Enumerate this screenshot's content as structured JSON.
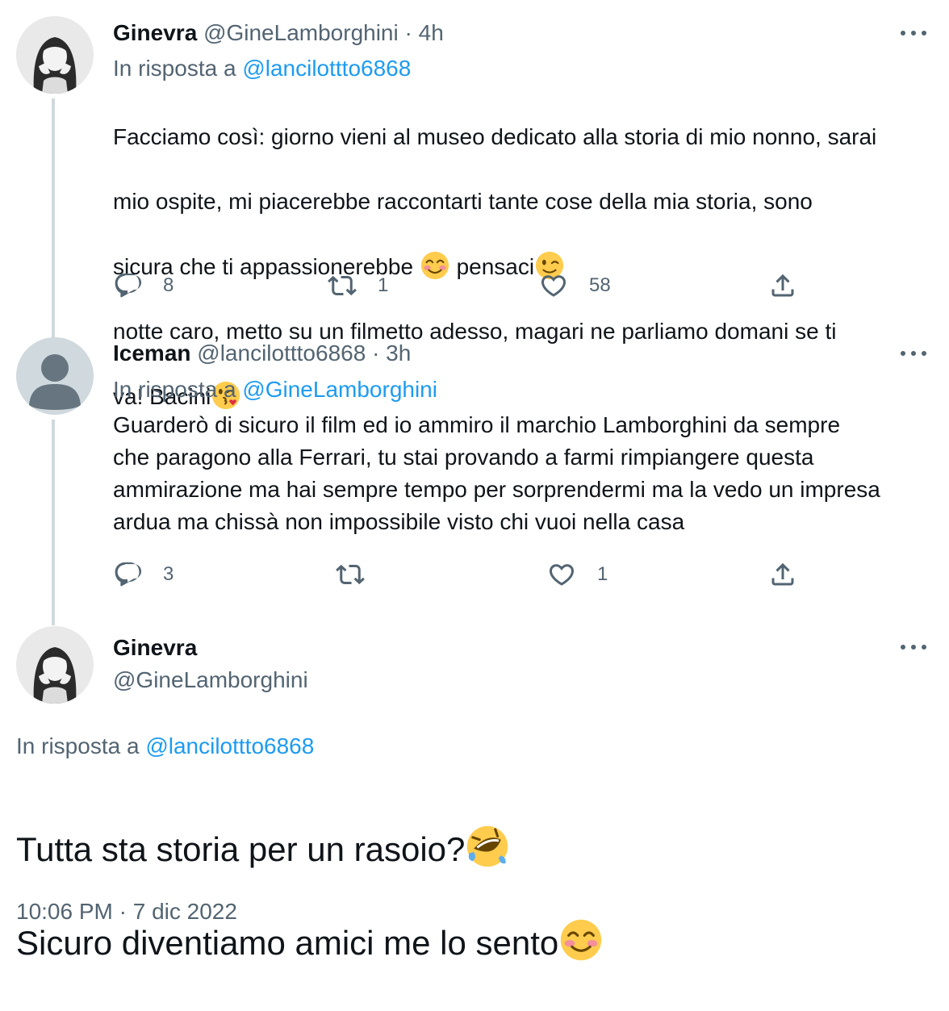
{
  "tweets": [
    {
      "name": "Ginevra",
      "handle": "@GineLamborghini",
      "time": "· 4h",
      "reply_prefix": "In risposta a",
      "reply_to": "@lancilottto6868",
      "text_lines": [
        "Facciamo così: giorno vieni al museo dedicato alla storia di mio nonno, sarai",
        "mio ospite, mi piacerebbe raccontarti tante cose della mia storia, sono",
        "sicura che ti appassionerebbe",
        "pensaci",
        "notte caro, metto su un filmetto adesso, magari ne parliamo domani se ti",
        "va! Bacini"
      ],
      "reply_count": "8",
      "retweet_count": "1",
      "like_count": "58"
    },
    {
      "name": "Iceman",
      "handle": "@lancilottto6868",
      "time": "· 3h",
      "reply_prefix": "In risposta a",
      "reply_to": "@GineLamborghini",
      "text": "Guarderò di sicuro il film ed io ammiro il marchio Lamborghini da sempre\nche paragono alla Ferrari, tu stai provando a farmi rimpiangere questa\nammirazione ma hai sempre tempo per sorprendermi ma la vedo un impresa\nardua ma chissà non impossibile visto chi vuoi nella casa",
      "reply_count": "3",
      "retweet_count": "",
      "like_count": "1"
    }
  ],
  "main_tweet": {
    "name": "Ginevra",
    "handle": "@GineLamborghini",
    "reply_prefix": "In risposta a",
    "reply_to": "@lancilottto6868",
    "line1": "Tutta sta storia per un rasoio?",
    "line2": "Sicuro diventiamo amici me lo sento",
    "timestamp": "10:06 PM · 7 dic 2022"
  },
  "icons": {
    "reply": "reply-icon",
    "retweet": "retweet-icon",
    "like": "like-icon",
    "share": "share-icon",
    "more": "more-icon"
  },
  "colors": {
    "link": "#1d9bf0",
    "muted": "#536471",
    "text": "#0f1419",
    "thread_line": "#cfd9de"
  }
}
